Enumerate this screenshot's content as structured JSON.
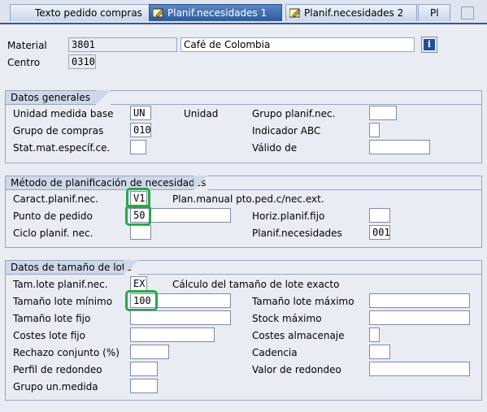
{
  "tabs": [
    {
      "label": "Texto pedido compras",
      "active": false
    },
    {
      "label": "Planif.necesidades 1",
      "active": true,
      "icon": "pencil-icon"
    },
    {
      "label": "Planif.necesidades 2",
      "active": false,
      "icon": "pencil-icon"
    },
    {
      "label": "Pl",
      "active": false
    }
  ],
  "header": {
    "material_label": "Material",
    "material_value": "3801",
    "material_desc": "Café de Colombia",
    "centro_label": "Centro",
    "centro_value": "0310",
    "info_icon": "info-icon"
  },
  "datos_generales": {
    "title": "Datos generales",
    "unidad_medida_base_label": "Unidad medida base",
    "unidad_medida_base_value": "UN",
    "unidad_medida_base_desc": "Unidad",
    "grupo_compras_label": "Grupo de compras",
    "grupo_compras_value": "010",
    "stat_mat_label": "Stat.mat.específ.ce.",
    "stat_mat_value": "",
    "grupo_planif_label": "Grupo planif.nec.",
    "grupo_planif_value": "",
    "indicador_abc_label": "Indicador ABC",
    "indicador_abc_value": "",
    "valido_de_label": "Válido de",
    "valido_de_value": ""
  },
  "metodo": {
    "title": "Método de planificación de necesidades",
    "caract_label": "Caract.planif.nec.",
    "caract_value": "V1",
    "caract_desc": "Plan.manual pto.ped.c/nec.ext.",
    "punto_pedido_label": "Punto de pedido",
    "punto_pedido_value": "50",
    "ciclo_label": "Ciclo planif. nec.",
    "ciclo_value": "",
    "horiz_label": "Horiz.planif.fijo",
    "horiz_value": "",
    "planificador_label": "Planif.necesidades",
    "planificador_value": "001"
  },
  "lote": {
    "title": "Datos de tamaño de lote",
    "tam_lote_label": "Tam.lote planif.nec.",
    "tam_lote_value": "EX",
    "tam_lote_desc": "Cálculo del tamaño de lote exacto",
    "minimo_label": "Tamaño lote mínimo",
    "minimo_value": "100",
    "fijo_label": "Tamaño lote fijo",
    "fijo_value": "",
    "costes_fijo_label": "Costes lote fijo",
    "costes_fijo_value": "",
    "rechazo_label": "Rechazo conjunto (%)",
    "rechazo_value": "",
    "perfil_label": "Perfil de redondeo",
    "perfil_value": "",
    "grupo_um_label": "Grupo un.medida",
    "grupo_um_value": "",
    "maximo_label": "Tamaño lote máximo",
    "maximo_value": "",
    "stock_max_label": "Stock máximo",
    "stock_max_value": "",
    "costes_alm_label": "Costes almacenaje",
    "costes_alm_value": "",
    "cadencia_label": "Cadencia",
    "cadencia_value": "",
    "valor_redondeo_label": "Valor de redondeo",
    "valor_redondeo_value": ""
  },
  "colors": {
    "highlight": "#27a844",
    "tab_active": "#2e5a9c",
    "background": "#e9ecf3"
  }
}
